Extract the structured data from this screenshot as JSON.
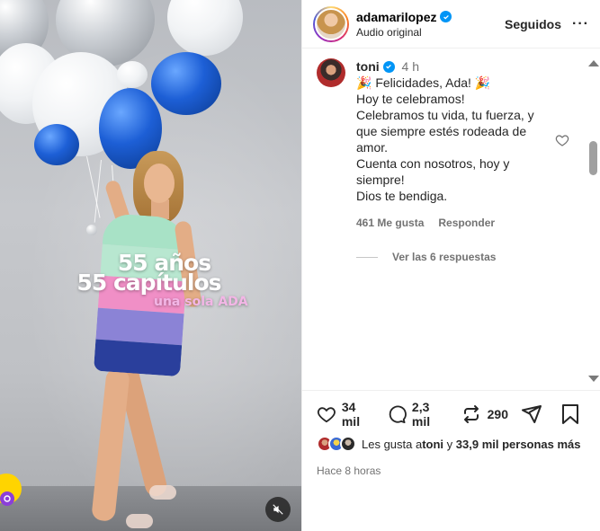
{
  "post": {
    "overlay_line1": "55 años",
    "overlay_line2": "55 capítulos",
    "overlay_line3": "una sola ADA"
  },
  "header": {
    "username": "adamarilopez",
    "subtitle": "Audio original",
    "follow_label": "Seguidos",
    "more_icon": "···"
  },
  "comment": {
    "username": "toni",
    "time": "4 h",
    "lines": [
      "🎉 Felicidades, Ada! 🎉",
      "Hoy te celebramos!",
      "Celebramos tu vida, tu fuerza, y",
      "que siempre estés rodeada de",
      "amor.",
      "Cuenta con nosotros, hoy y",
      "siempre!",
      "Dios te bendiga."
    ],
    "likes": "461 Me gusta",
    "reply_label": "Responder",
    "view_replies": "Ver las 6 respuestas"
  },
  "actions": {
    "likes_count": "34 mil",
    "comments_count": "2,3 mil",
    "reposts_count": "290"
  },
  "likes_summary": {
    "prefix": "Les gusta a ",
    "user": "toni",
    "middle": " y ",
    "others": "33,9 mil personas más"
  },
  "time_ago": "Hace 8 horas",
  "icons": [
    "verified-icon",
    "more-icon",
    "heart-icon",
    "comment-icon",
    "repost-icon",
    "share-icon",
    "save-icon",
    "mute-icon"
  ],
  "colors": {
    "verified": "#0095f6",
    "secondary_text": "#737373"
  }
}
